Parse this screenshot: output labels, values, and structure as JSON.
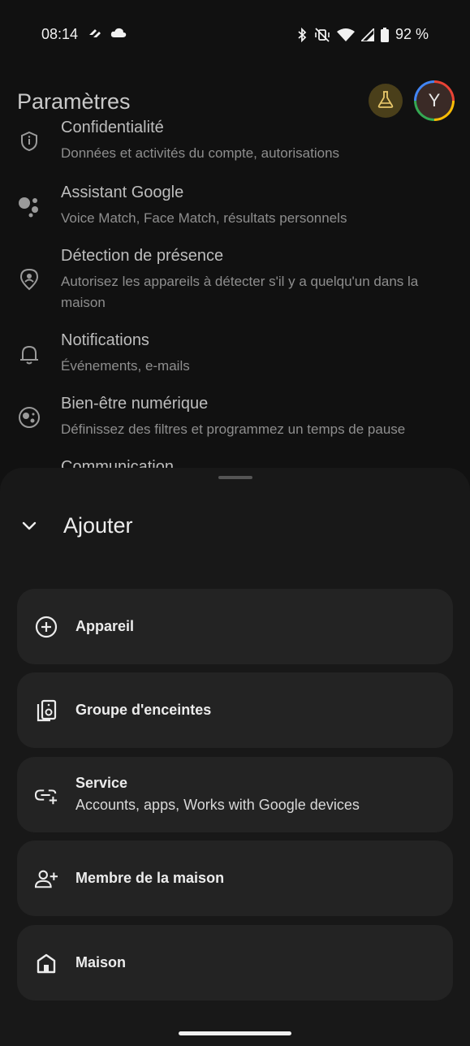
{
  "status_bar": {
    "time": "08:14",
    "battery": "92 %",
    "icons_left": [
      "signal-sync-icon",
      "cloud-icon"
    ],
    "icons_right": [
      "bluetooth-icon",
      "vibrate-off-icon",
      "wifi-icon",
      "cell-signal-icon",
      "battery-icon"
    ]
  },
  "header": {
    "title": "Paramètres",
    "labs_icon": "flask-icon",
    "avatar_initial": "Y"
  },
  "settings": {
    "items": [
      {
        "title": "Confidentialité",
        "subtitle": "Données et activités du compte, autorisations",
        "icon": "shield-icon"
      },
      {
        "title": "Assistant Google",
        "subtitle": "Voice Match, Face Match, résultats personnels",
        "icon": "assistant-icon"
      },
      {
        "title": "Détection de présence",
        "subtitle": "Autorisez les appareils à détecter s'il y a quelqu'un dans la maison",
        "icon": "presence-icon"
      },
      {
        "title": "Notifications",
        "subtitle": "Événements, e-mails",
        "icon": "bell-icon"
      },
      {
        "title": "Bien-être numérique",
        "subtitle": "Définissez des filtres et programmez un temps de pause",
        "icon": "wellbeing-icon"
      },
      {
        "title": "Communication",
        "subtitle": "",
        "icon": ""
      }
    ]
  },
  "sheet": {
    "title": "Ajouter",
    "options": [
      {
        "label": "Appareil",
        "subtitle": "",
        "icon": "add-circle-icon"
      },
      {
        "label": "Groupe d'enceintes",
        "subtitle": "",
        "icon": "speaker-group-icon"
      },
      {
        "label": "Service",
        "subtitle": "Accounts, apps, Works with Google devices",
        "icon": "link-add-icon"
      },
      {
        "label": "Membre de la maison",
        "subtitle": "",
        "icon": "person-add-icon"
      },
      {
        "label": "Maison",
        "subtitle": "",
        "icon": "home-icon"
      }
    ]
  },
  "colors": {
    "background": "#111111",
    "sheet": "#181818",
    "card": "#232323",
    "labs_badge": "#4a3f1a"
  }
}
